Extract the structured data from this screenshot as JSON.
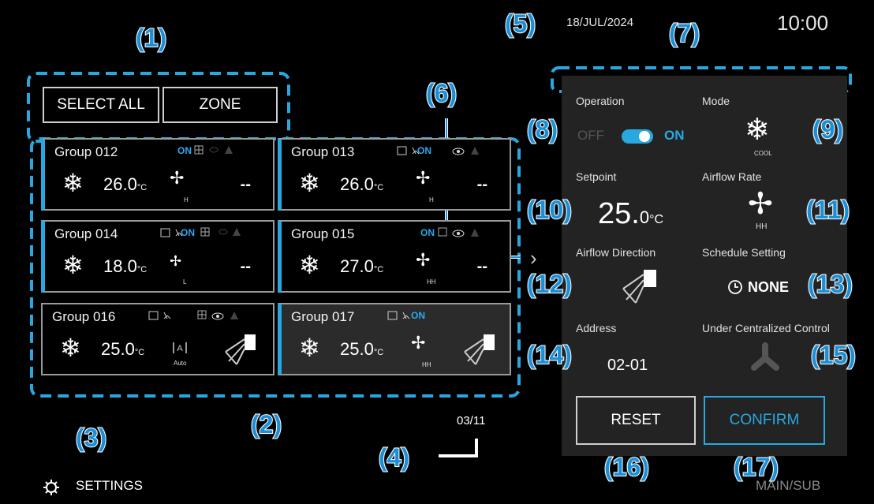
{
  "header": {
    "date": "18/JUL/2024",
    "time": "10:00"
  },
  "toolbar": {
    "select_all": "SELECT ALL",
    "zone": "ZONE"
  },
  "groups": [
    {
      "name": "Group 012",
      "status": "ON",
      "temp": "26.0",
      "unit": "°C",
      "fan": "H",
      "extra": "--"
    },
    {
      "name": "Group 013",
      "status": "ON",
      "temp": "26.0",
      "unit": "°C",
      "fan": "H",
      "extra": "--"
    },
    {
      "name": "Group 014",
      "status": "ON",
      "temp": "18.0",
      "unit": "°C",
      "fan": "L",
      "extra": "--"
    },
    {
      "name": "Group 015",
      "status": "ON",
      "temp": "27.0",
      "unit": "°C",
      "fan": "HH",
      "extra": "--"
    },
    {
      "name": "Group 016",
      "status": "",
      "temp": "25.0",
      "unit": "°C",
      "fan": "Auto",
      "extra": ""
    },
    {
      "name": "Group 017",
      "status": "ON",
      "temp": "25.0",
      "unit": "°C",
      "fan": "HH",
      "extra": ""
    }
  ],
  "pagination": {
    "page": "03/11"
  },
  "footer": {
    "settings": "SETTINGS",
    "main_sub": "MAIN/SUB"
  },
  "panel": {
    "operation_label": "Operation",
    "off": "OFF",
    "on": "ON",
    "mode_label": "Mode",
    "mode_value": "COOL",
    "setpoint_label": "Setpoint",
    "setpoint_value": "25.",
    "setpoint_decimal": "0",
    "setpoint_unit": "°C",
    "airflow_rate_label": "Airflow Rate",
    "airflow_rate_value": "HH",
    "airflow_direction_label": "Airflow Direction",
    "schedule_label": "Schedule Setting",
    "schedule_value": "NONE",
    "address_label": "Address",
    "address_value": "02-01",
    "centralized_label": "Under Centralized Control",
    "reset": "RESET",
    "confirm": "CONFIRM"
  },
  "annotations": [
    "(1)",
    "(2)",
    "(3)",
    "(4)",
    "(5)",
    "(6)",
    "(7)",
    "(8)",
    "(9)",
    "(10)",
    "(11)",
    "(12)",
    "(13)",
    "(14)",
    "(15)",
    "(16)",
    "(17)"
  ],
  "colors": {
    "accent": "#29a8e0",
    "annotation": "#1a8fd8",
    "panel": "#232323"
  }
}
